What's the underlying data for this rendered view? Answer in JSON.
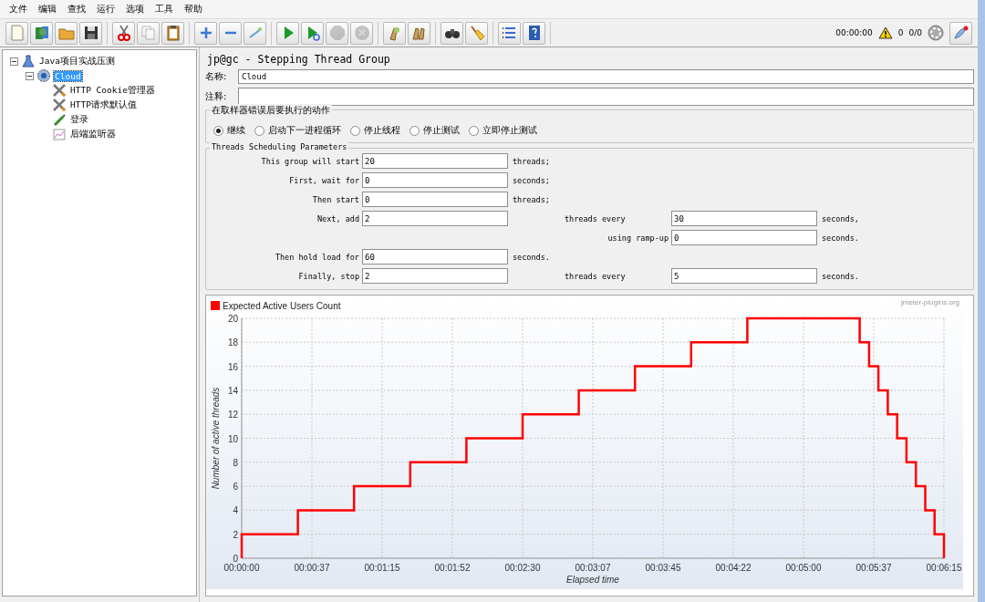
{
  "menu": [
    "文件",
    "编辑",
    "查找",
    "运行",
    "选项",
    "工具",
    "帮助"
  ],
  "toolbar_groups": [
    [
      {
        "kind": "new",
        "disabled": false
      },
      {
        "kind": "templates",
        "disabled": false
      },
      {
        "kind": "open",
        "disabled": false
      },
      {
        "kind": "save",
        "disabled": false
      }
    ],
    [
      {
        "kind": "cut",
        "disabled": false
      },
      {
        "kind": "copy",
        "disabled": true
      },
      {
        "kind": "paste",
        "disabled": false
      }
    ],
    [
      {
        "kind": "expand",
        "disabled": false
      },
      {
        "kind": "collapse",
        "disabled": false
      },
      {
        "kind": "toggle",
        "disabled": false
      }
    ],
    [
      {
        "kind": "start",
        "disabled": false
      },
      {
        "kind": "start_no_pauses",
        "disabled": false
      },
      {
        "kind": "stop",
        "disabled": true
      },
      {
        "kind": "shutdown",
        "disabled": true
      }
    ],
    [
      {
        "kind": "clear",
        "disabled": false
      },
      {
        "kind": "clear_all",
        "disabled": false
      }
    ],
    [
      {
        "kind": "search",
        "disabled": false
      },
      {
        "kind": "reset_search",
        "disabled": false
      }
    ],
    [
      {
        "kind": "functions",
        "disabled": false
      },
      {
        "kind": "help",
        "disabled": false
      }
    ]
  ],
  "status": {
    "elapsed": "00:00:00",
    "warnings": "0",
    "threads": "0/0"
  },
  "tree": [
    {
      "label": "Java项目实战压测",
      "kind": "test_plan",
      "selected": false,
      "expanded": true,
      "children": [
        {
          "label": "Cloud",
          "kind": "thread_group",
          "selected": true,
          "expanded": true,
          "children": [
            {
              "label": "HTTP Cookie管理器",
              "kind": "config",
              "selected": false
            },
            {
              "label": "HTTP请求默认值",
              "kind": "config",
              "selected": false
            },
            {
              "label": "登录",
              "kind": "sampler",
              "selected": false
            },
            {
              "label": "后端监听器",
              "kind": "listener",
              "selected": false
            }
          ]
        }
      ]
    }
  ],
  "panel": {
    "title": "jp@gc - Stepping Thread Group",
    "name_label": "名称:",
    "name_value": "Cloud",
    "comment_label": "注释:",
    "error_action": {
      "title": "在取样器错误后要执行的动作",
      "options": [
        {
          "label": "继续",
          "selected": true
        },
        {
          "label": "启动下一进程循环",
          "selected": false
        },
        {
          "label": "停止线程",
          "selected": false
        },
        {
          "label": "停止测试",
          "selected": false
        },
        {
          "label": "立即停止测试",
          "selected": false
        }
      ]
    },
    "scheduling": {
      "title": "Threads Scheduling Parameters",
      "rows": [
        {
          "label": "This group will start",
          "value": "20",
          "unit": "threads;"
        },
        {
          "label": "First, wait for",
          "value": "0",
          "unit": "seconds;"
        },
        {
          "label": "Then start",
          "value": "0",
          "unit": "threads;"
        },
        {
          "label": "Next, add",
          "value": "2",
          "label2": "threads every",
          "value2": "30",
          "unit2": "seconds,"
        },
        {
          "label2": "using ramp-up",
          "value2": "0",
          "unit2": "seconds."
        },
        {
          "label": "Then hold load for",
          "value": "60",
          "unit": "seconds."
        },
        {
          "label": "Finally, stop",
          "value": "2",
          "label2": "threads every",
          "value2": "5",
          "unit2": "seconds."
        }
      ]
    },
    "chart": {
      "credit": "jmeter-plugins.org",
      "chart_data": {
        "type": "line",
        "grid": true,
        "xlabel": "Elapsed time",
        "ylabel": "Number of active threads",
        "xlim": [
          0,
          375
        ],
        "ylim": [
          0,
          20
        ],
        "xticks": [
          {
            "value": 0,
            "label": "00:00:00"
          },
          {
            "value": 37.5,
            "label": "00:00:37"
          },
          {
            "value": 75,
            "label": "00:01:15"
          },
          {
            "value": 112.5,
            "label": "00:01:52"
          },
          {
            "value": 150,
            "label": "00:02:30"
          },
          {
            "value": 187.5,
            "label": "00:03:07"
          },
          {
            "value": 225,
            "label": "00:03:45"
          },
          {
            "value": 262.5,
            "label": "00:04:22"
          },
          {
            "value": 300,
            "label": "00:05:00"
          },
          {
            "value": 337.5,
            "label": "00:05:37"
          },
          {
            "value": 375,
            "label": "00:06:15"
          }
        ],
        "yticks": [
          0,
          2,
          4,
          6,
          8,
          10,
          12,
          14,
          16,
          18,
          20
        ],
        "x": [
          0,
          0,
          30,
          30,
          60,
          60,
          90,
          90,
          120,
          120,
          150,
          150,
          180,
          180,
          210,
          210,
          240,
          240,
          270,
          270,
          330,
          330,
          335,
          335,
          340,
          340,
          345,
          345,
          350,
          350,
          355,
          355,
          360,
          360,
          365,
          365,
          370,
          370,
          375,
          375
        ],
        "series": [
          {
            "name": "Expected Active Users Count",
            "color": "#ff0000",
            "values": [
              0,
              2,
              2,
              4,
              4,
              6,
              6,
              8,
              8,
              10,
              10,
              12,
              12,
              14,
              14,
              16,
              16,
              18,
              18,
              20,
              20,
              18,
              18,
              16,
              16,
              14,
              14,
              12,
              12,
              10,
              10,
              8,
              8,
              6,
              6,
              4,
              4,
              2,
              2,
              0
            ]
          }
        ]
      }
    }
  }
}
